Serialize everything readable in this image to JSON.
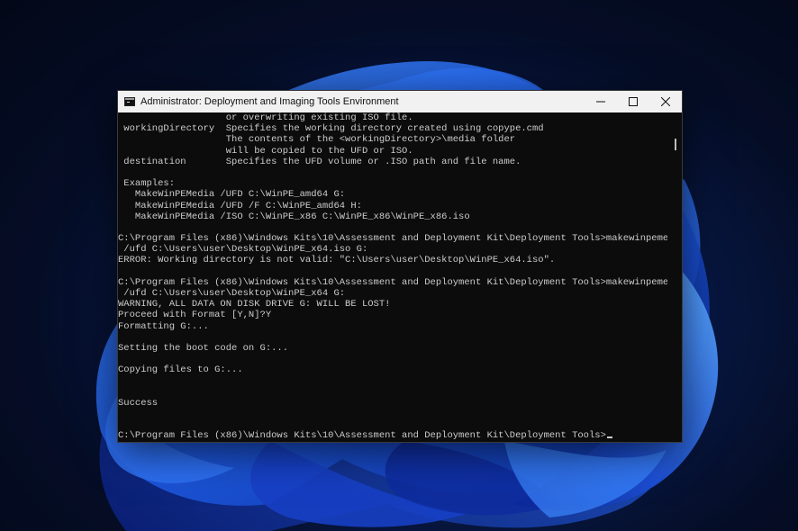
{
  "window": {
    "title": "Administrator: Deployment and Imaging Tools Environment",
    "icons": {
      "app": "command-prompt-icon",
      "minimize": "minimize-icon",
      "maximize": "maximize-icon",
      "close": "close-icon"
    }
  },
  "terminal": {
    "lines": [
      "                   or overwriting existing ISO file.",
      " workingDirectory  Specifies the working directory created using copype.cmd",
      "                   The contents of the <workingDirectory>\\media folder",
      "                   will be copied to the UFD or ISO.",
      " destination       Specifies the UFD volume or .ISO path and file name.",
      "",
      " Examples:",
      "   MakeWinPEMedia /UFD C:\\WinPE_amd64 G:",
      "   MakeWinPEMedia /UFD /F C:\\WinPE_amd64 H:",
      "   MakeWinPEMedia /ISO C:\\WinPE_x86 C:\\WinPE_x86\\WinPE_x86.iso",
      "",
      "C:\\Program Files (x86)\\Windows Kits\\10\\Assessment and Deployment Kit\\Deployment Tools>makewinpemedia",
      " /ufd C:\\Users\\user\\Desktop\\WinPE_x64.iso G:",
      "ERROR: Working directory is not valid: \"C:\\Users\\user\\Desktop\\WinPE_x64.iso\".",
      "",
      "C:\\Program Files (x86)\\Windows Kits\\10\\Assessment and Deployment Kit\\Deployment Tools>makewinpemedia",
      " /ufd C:\\Users\\user\\Desktop\\WinPE_x64 G:",
      "WARNING, ALL DATA ON DISK DRIVE G: WILL BE LOST!",
      "Proceed with Format [Y,N]?Y",
      "Formatting G:...",
      "",
      "Setting the boot code on G:...",
      "",
      "Copying files to G:...",
      "",
      "",
      "Success",
      "",
      "",
      "C:\\Program Files (x86)\\Windows Kits\\10\\Assessment and Deployment Kit\\Deployment Tools>"
    ]
  }
}
